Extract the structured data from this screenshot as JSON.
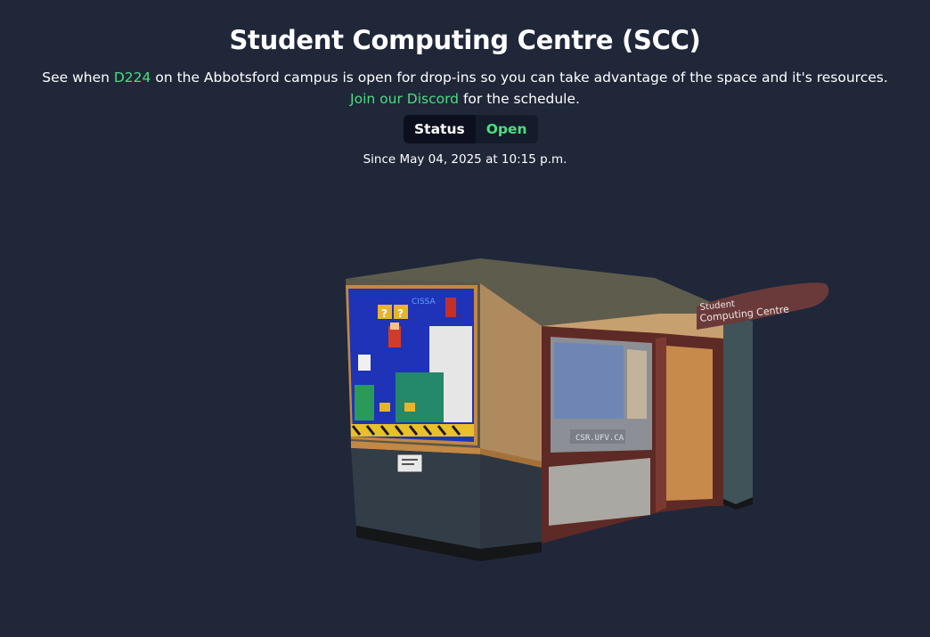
{
  "header": {
    "title": "Student Computing Centre (SCC)",
    "line1_prefix": "See when ",
    "room_link": "D224",
    "line1_suffix": " on the Abbotsford campus is open for drop-ins so you can take advantage of the space and it's resources.",
    "discord_link": "Join our Discord",
    "line2_suffix": " for the schedule."
  },
  "status": {
    "label": "Status",
    "value": "Open",
    "since": "Since May 04, 2025 at 10:15 p.m."
  },
  "scene": {
    "sign_line1": "Student",
    "sign_line2": "Computing Centre",
    "poster_text": "CISSA",
    "window_label": "CSR.UFV.CA",
    "colors": {
      "wall": "#5c5a4b",
      "lower_wall": "#333d47",
      "trim": "#c28844",
      "door_frame": "#5e2a26",
      "accent": "#4ade80"
    }
  }
}
